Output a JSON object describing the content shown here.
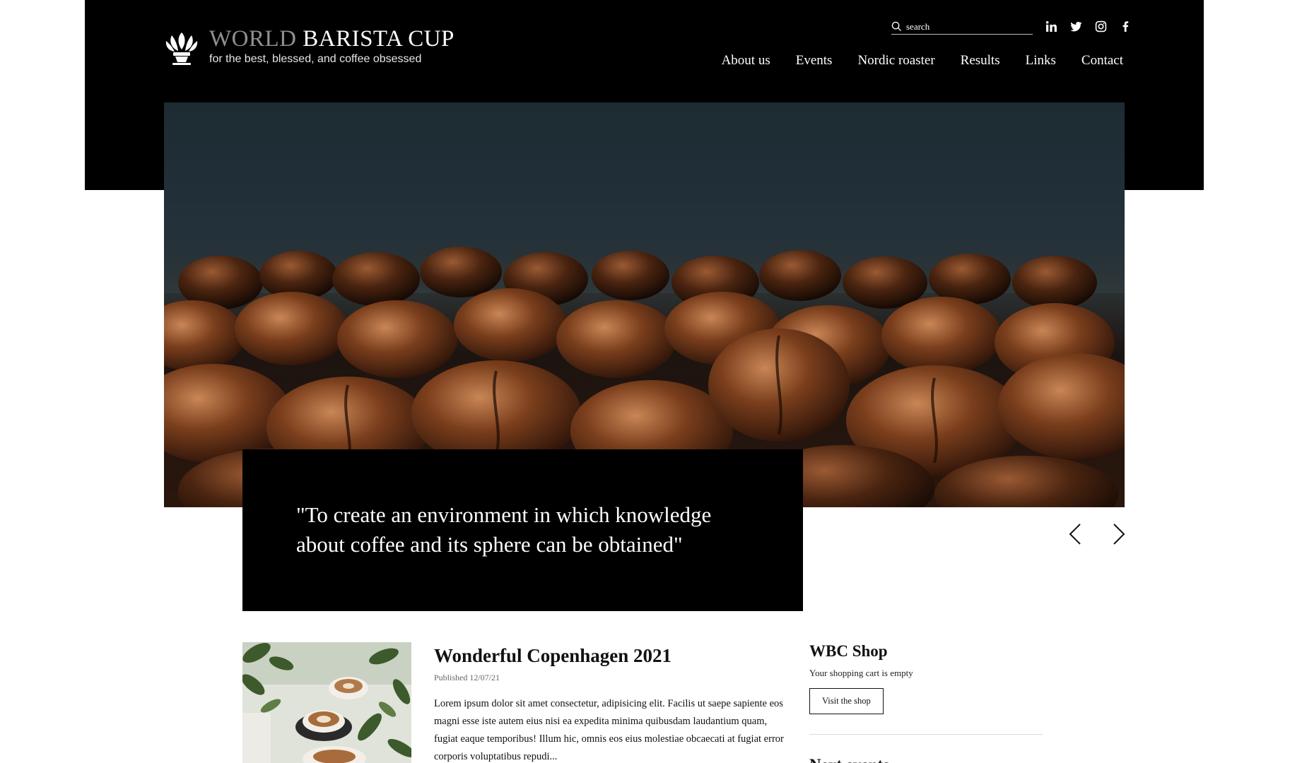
{
  "brand": {
    "title_part1": "WORLD",
    "title_part2": "BARISTA CUP",
    "tagline": "for the best, blessed, and coffee obsessed"
  },
  "search": {
    "placeholder": "search"
  },
  "social": [
    "linkedin-icon",
    "twitter-icon",
    "instagram-icon",
    "facebook-icon"
  ],
  "nav": {
    "items": [
      {
        "label": "About us"
      },
      {
        "label": "Events"
      },
      {
        "label": "Nordic roaster"
      },
      {
        "label": "Results"
      },
      {
        "label": "Links"
      },
      {
        "label": "Contact"
      }
    ]
  },
  "hero": {
    "quote": "\"To create an environment in which knowledge about coffee and its sphere can be obtained\""
  },
  "article": {
    "title": "Wonderful Copenhagen 2021",
    "date": "Published 12/07/21",
    "excerpt": "Lorem ipsum dolor sit amet consectetur, adipisicing elit. Facilis ut saepe sapiente eos magni esse iste autem eius nisi ea expedita minima quibusdam laudantium quam, fugiat eaque temporibus! Illum hic, omnis eos eius molestiae obcaecati at fugiat error corporis voluptatibus repudi..."
  },
  "shop": {
    "title": "WBC Shop",
    "cart_status": "Your shopping cart is empty",
    "button_label": "Visit the shop",
    "next_heading": "Next events"
  },
  "colors": {
    "header_bg": "#000000",
    "page_bg": "#ffffff",
    "text": "#111111",
    "muted_title": "#8f8f8f"
  }
}
